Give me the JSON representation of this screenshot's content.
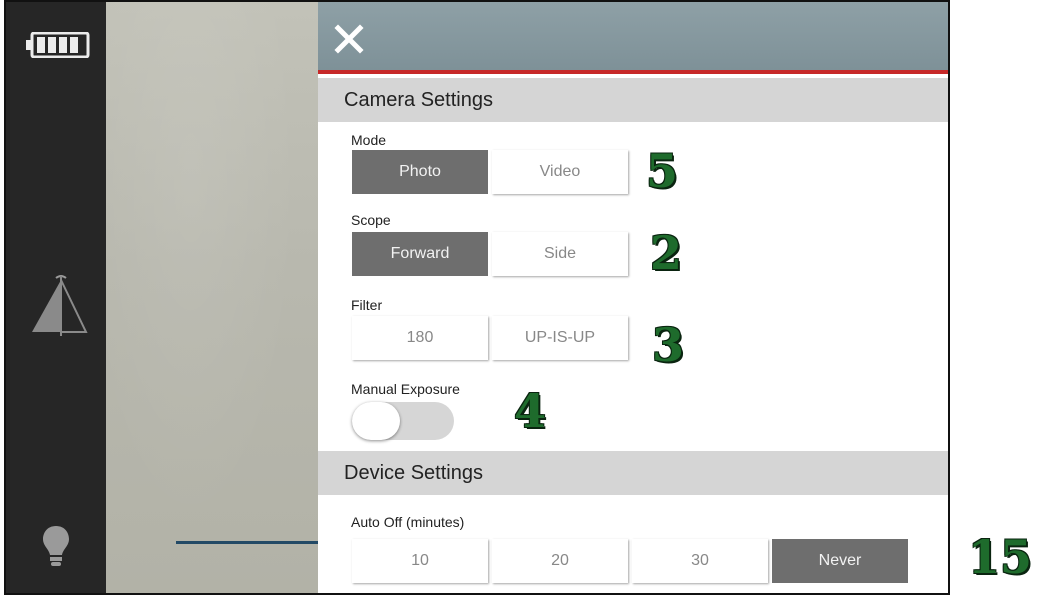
{
  "camera_settings": {
    "header": "Camera Settings",
    "mode": {
      "label": "Mode",
      "options": [
        "Photo",
        "Video"
      ],
      "selected": "Photo"
    },
    "scope": {
      "label": "Scope",
      "options": [
        "Forward",
        "Side"
      ],
      "selected": "Forward"
    },
    "filter": {
      "label": "Filter",
      "options": [
        "180",
        "UP-IS-UP"
      ],
      "selected": null
    },
    "manual_exposure": {
      "label": "Manual Exposure",
      "on": false
    }
  },
  "device_settings": {
    "header": "Device Settings",
    "auto_off": {
      "label": "Auto Off (minutes)",
      "options": [
        "10",
        "20",
        "30",
        "Never"
      ],
      "selected": "Never"
    }
  },
  "annotations": [
    "5",
    "2",
    "3",
    "4",
    "15"
  ],
  "icons": [
    "battery-icon",
    "level-icon",
    "bulb-icon",
    "close-icon"
  ],
  "colors": {
    "accent_line": "#c62828",
    "selected_segment": "#6e6e6e",
    "badge_green": "#1e6b2c"
  }
}
